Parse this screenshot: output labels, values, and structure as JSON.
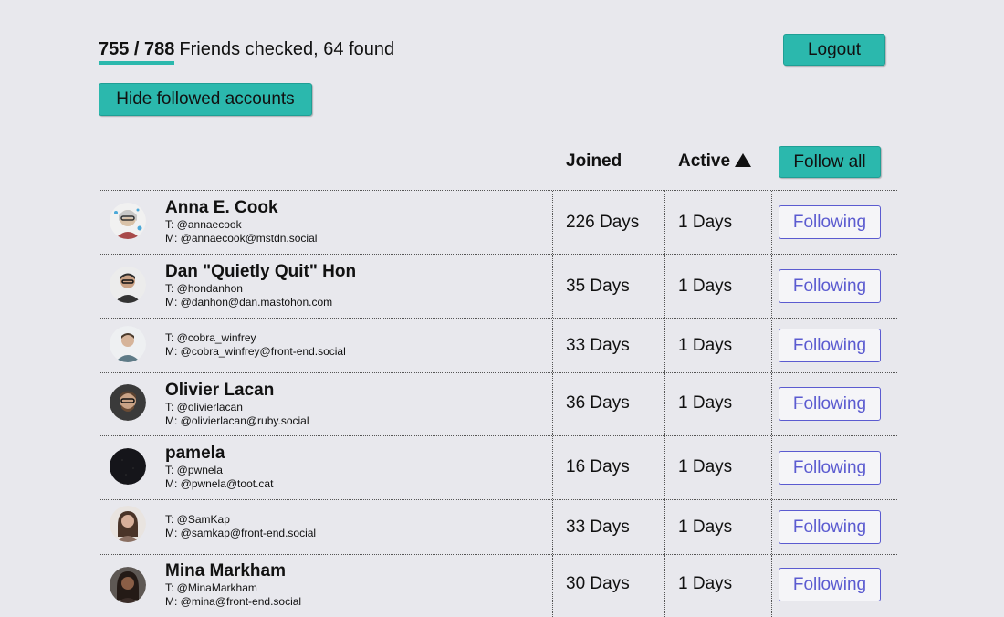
{
  "progress": {
    "count": "755 / 788",
    "text": "Friends checked, 64 found"
  },
  "buttons": {
    "logout": "Logout",
    "hide_followed": "Hide followed accounts",
    "follow_all": "Follow all"
  },
  "columns": {
    "joined": "Joined",
    "active": "Active",
    "sort_icon": "sort-ascending-triangle"
  },
  "colors": {
    "accent": "#2bb8ad",
    "following": "#5b5bd0",
    "background": "#e8e8ed"
  },
  "rows": [
    {
      "name": "Anna E. Cook",
      "twitter": "T: @annaecook",
      "mastodon": "M: @annaecook@mstdn.social",
      "joined": "226 Days",
      "active": "1 Days",
      "button": "Following"
    },
    {
      "name": "Dan \"Quietly Quit\" Hon",
      "twitter": "T: @hondanhon",
      "mastodon": "M: @danhon@dan.mastohon.com",
      "joined": "35 Days",
      "active": "1 Days",
      "button": "Following"
    },
    {
      "name": "",
      "twitter": "T: @cobra_winfrey",
      "mastodon": "M: @cobra_winfrey@front-end.social",
      "joined": "33 Days",
      "active": "1 Days",
      "button": "Following"
    },
    {
      "name": "Olivier Lacan",
      "twitter": "T: @olivierlacan",
      "mastodon": "M: @olivierlacan@ruby.social",
      "joined": "36 Days",
      "active": "1 Days",
      "button": "Following"
    },
    {
      "name": "pamela",
      "twitter": "T: @pwnela",
      "mastodon": "M: @pwnela@toot.cat",
      "joined": "16 Days",
      "active": "1 Days",
      "button": "Following"
    },
    {
      "name": "",
      "twitter": "T: @SamKap",
      "mastodon": "M: @samkap@front-end.social",
      "joined": "33 Days",
      "active": "1 Days",
      "button": "Following"
    },
    {
      "name": "Mina Markham",
      "twitter": "T: @MinaMarkham",
      "mastodon": "M: @mina@front-end.social",
      "joined": "30 Days",
      "active": "1 Days",
      "button": "Following"
    }
  ]
}
